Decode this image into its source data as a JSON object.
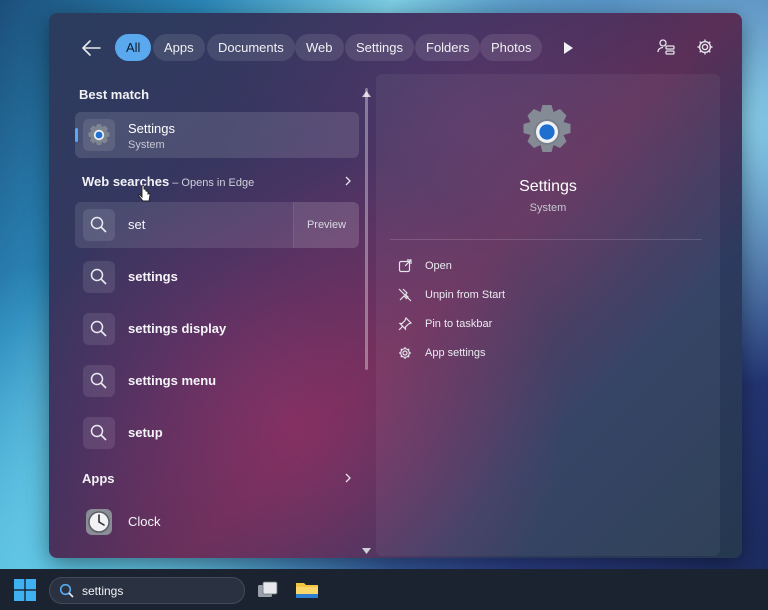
{
  "filters": [
    "All",
    "Apps",
    "Documents",
    "Web",
    "Settings",
    "Folders",
    "Photos"
  ],
  "best_match": {
    "heading": "Best match",
    "title": "Settings",
    "subtitle": "System"
  },
  "web_searches": {
    "heading": "Web searches",
    "note": " – Opens in Edge",
    "preview_label": "Preview",
    "items": [
      "set",
      "settings",
      "settings display",
      "settings menu",
      "setup"
    ]
  },
  "apps": {
    "heading": "Apps",
    "items": [
      "Clock"
    ]
  },
  "detail": {
    "title": "Settings",
    "subtitle": "System",
    "actions": [
      "Open",
      "Unpin from Start",
      "Pin to taskbar",
      "App settings"
    ]
  },
  "taskbar": {
    "search_value": "settings"
  },
  "colors": {
    "accent": "#5aa9ee",
    "gear_blue": "#1f6fd1"
  }
}
